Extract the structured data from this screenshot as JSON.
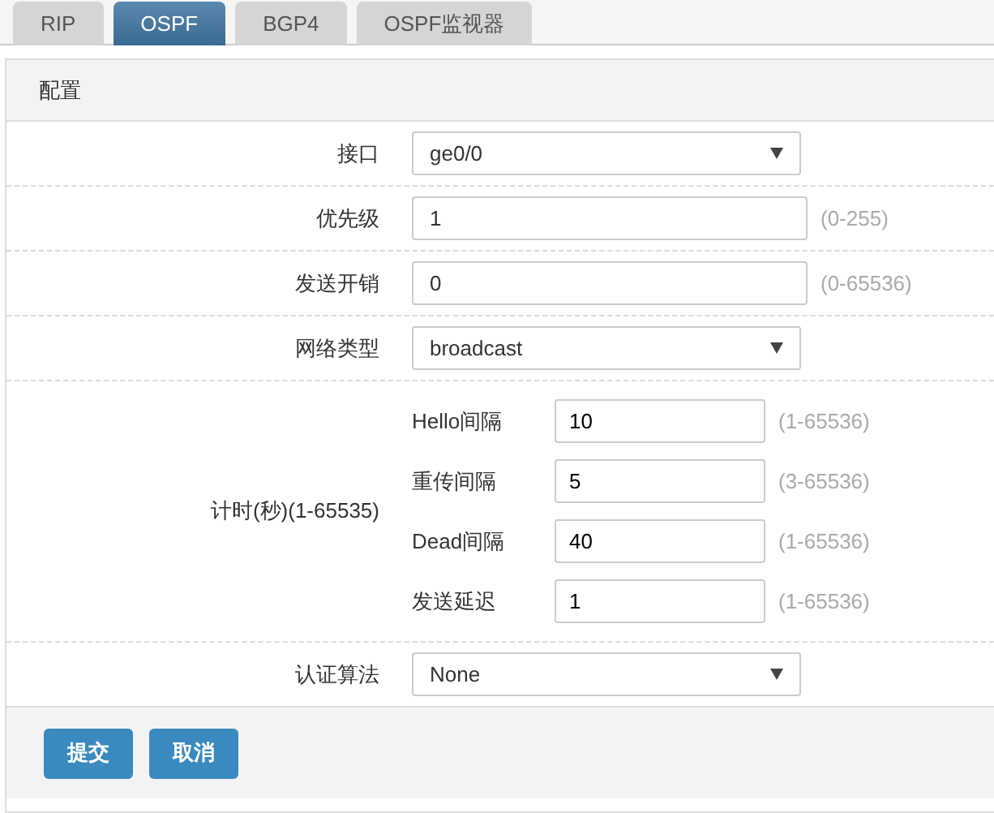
{
  "tabs": [
    {
      "label": "RIP",
      "selected": false
    },
    {
      "label": "OSPF",
      "selected": true
    },
    {
      "label": "BGP4",
      "selected": false
    },
    {
      "label": "OSPF监视器",
      "selected": false
    }
  ],
  "panel": {
    "title": "配置"
  },
  "rows": [
    {
      "kind": "select",
      "label": "接口",
      "value": "ge0/0"
    },
    {
      "kind": "input",
      "label": "优先级",
      "value": "1",
      "hint": "(0-255)"
    },
    {
      "kind": "input",
      "label": "发送开销",
      "value": "0",
      "hint": "(0-65536)"
    },
    {
      "kind": "select",
      "label": "网络类型",
      "value": "broadcast"
    },
    {
      "kind": "group",
      "label": "计时(秒)(1-65535)",
      "fields": [
        {
          "label": "Hello间隔",
          "value": "10",
          "hint": "(1-65536)"
        },
        {
          "label": "重传间隔",
          "value": "5",
          "hint": "(3-65536)"
        },
        {
          "label": "Dead间隔",
          "value": "40",
          "hint": "(1-65536)"
        },
        {
          "label": "发送延迟",
          "value": "1",
          "hint": "(1-65536)"
        }
      ]
    },
    {
      "kind": "select",
      "label": "认证算法",
      "value": "None"
    }
  ],
  "buttons": [
    "提交",
    "取消"
  ]
}
